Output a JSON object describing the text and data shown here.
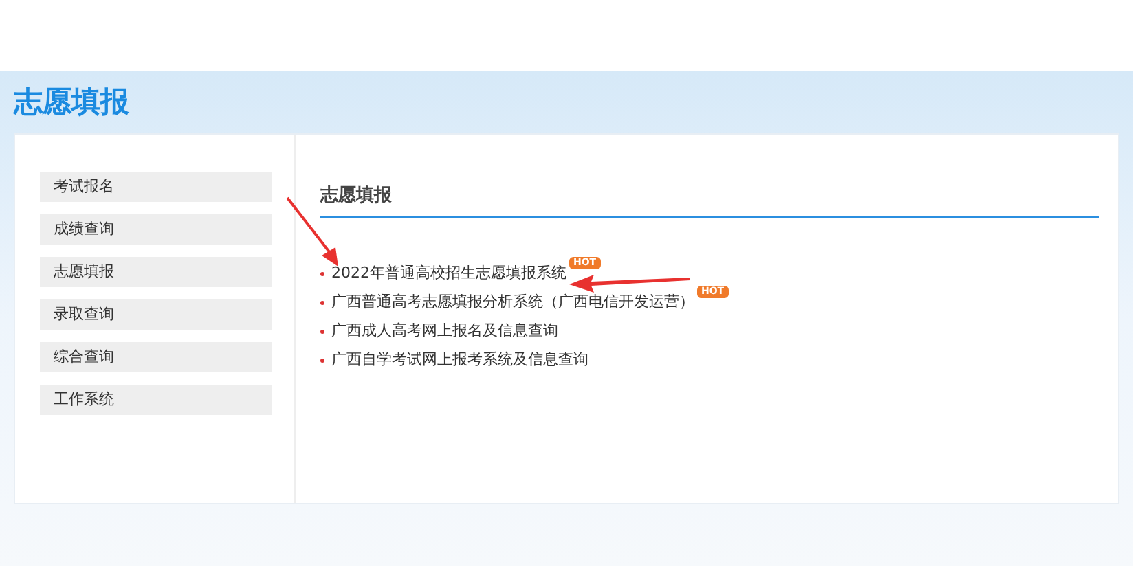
{
  "page_title": "志愿填报",
  "sidebar": {
    "items": [
      {
        "label": "考试报名"
      },
      {
        "label": "成绩查询"
      },
      {
        "label": "志愿填报"
      },
      {
        "label": "录取查询"
      },
      {
        "label": "综合查询"
      },
      {
        "label": "工作系统"
      }
    ]
  },
  "content": {
    "heading": "志愿填报",
    "links": [
      {
        "label": "2022年普通高校招生志愿填报系统",
        "badge": "HOT"
      },
      {
        "label": "广西普通高考志愿填报分析系统（广西电信开发运营）",
        "badge": "HOT"
      },
      {
        "label": "广西成人高考网上报名及信息查询"
      },
      {
        "label": "广西自学考试网上报考系统及信息查询"
      }
    ]
  }
}
